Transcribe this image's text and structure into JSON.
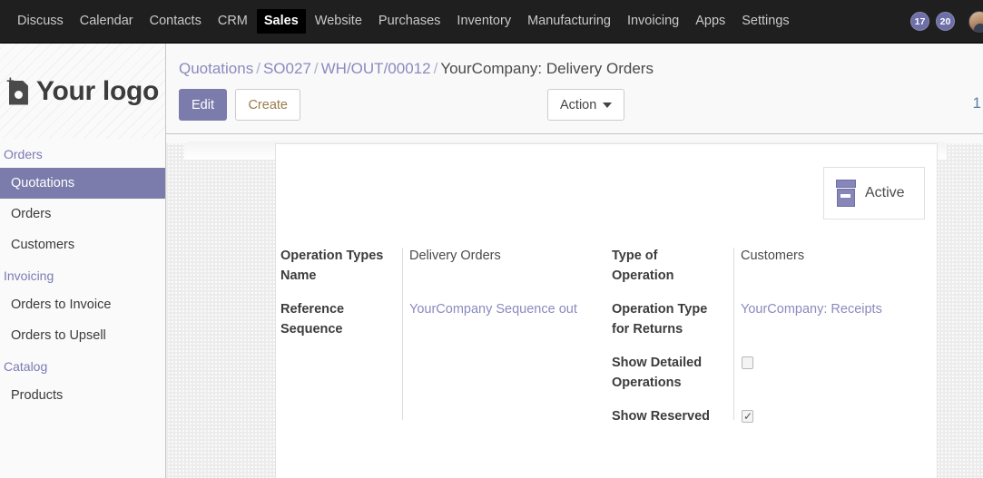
{
  "topbar": {
    "apps": [
      {
        "label": "Discuss",
        "active": false
      },
      {
        "label": "Calendar",
        "active": false
      },
      {
        "label": "Contacts",
        "active": false
      },
      {
        "label": "CRM",
        "active": false
      },
      {
        "label": "Sales",
        "active": true
      },
      {
        "label": "Website",
        "active": false
      },
      {
        "label": "Purchases",
        "active": false
      },
      {
        "label": "Inventory",
        "active": false
      },
      {
        "label": "Manufacturing",
        "active": false
      },
      {
        "label": "Invoicing",
        "active": false
      },
      {
        "label": "Apps",
        "active": false
      },
      {
        "label": "Settings",
        "active": false
      }
    ],
    "badges": [
      {
        "name": "messages-badge",
        "count": "17"
      },
      {
        "name": "activities-badge",
        "count": "20"
      }
    ],
    "avatar_name": "user-avatar",
    "background": "#1f1f1f",
    "active_item_background": "#000000"
  },
  "sidebar": {
    "logo_text": "Your logo",
    "logo_icon": "add-image-icon",
    "accent": "#7b7bac",
    "sections": [
      {
        "title": "Orders",
        "items": [
          {
            "label": "Quotations",
            "selected": true
          },
          {
            "label": "Orders",
            "selected": false
          },
          {
            "label": "Customers",
            "selected": false
          }
        ]
      },
      {
        "title": "Invoicing",
        "items": [
          {
            "label": "Orders to Invoice",
            "selected": false
          },
          {
            "label": "Orders to Upsell",
            "selected": false
          }
        ]
      },
      {
        "title": "Catalog",
        "items": [
          {
            "label": "Products",
            "selected": false
          }
        ]
      }
    ]
  },
  "breadcrumb": {
    "items": [
      "Quotations",
      "SO027",
      "WH/OUT/00012"
    ],
    "separator": "/",
    "current": "YourCompany: Delivery Orders"
  },
  "controls": {
    "edit_label": "Edit",
    "create_label": "Create",
    "action_label": "Action",
    "pager_text": "1"
  },
  "card": {
    "active_button": {
      "label": "Active",
      "icon": "archive-box-icon"
    },
    "left_column": [
      {
        "label": "Operation Types Name",
        "value": "Delivery Orders",
        "type": "text",
        "name": "operation-types-name"
      },
      {
        "label": "Reference Sequence",
        "value": "YourCompany Sequence out",
        "type": "link",
        "name": "reference-sequence"
      }
    ],
    "right_column": [
      {
        "label": "Type of Operation",
        "value": "Customers",
        "type": "text",
        "name": "type-of-operation"
      },
      {
        "label": "Operation Type for Returns",
        "value": "YourCompany: Receipts",
        "type": "link",
        "name": "operation-type-for-returns"
      },
      {
        "label": "Show Detailed Operations",
        "value": "",
        "type": "checkbox",
        "checked": false,
        "name": "show-detailed-operations"
      },
      {
        "label": "Show Reserved",
        "value": "",
        "type": "checkbox",
        "checked": true,
        "name": "show-reserved"
      }
    ]
  }
}
